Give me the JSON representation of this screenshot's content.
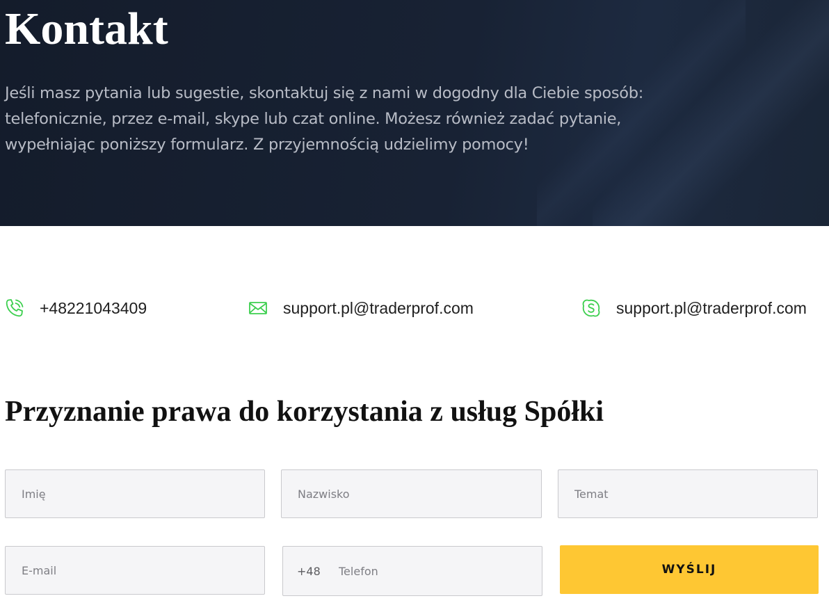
{
  "hero": {
    "title": "Kontakt",
    "text": "Jeśli masz pytania lub sugestie, skontaktuj się z nami w dogodny dla Ciebie sposób: telefonicznie, przez e-mail, skype lub czat online. Możesz również zadać pytanie, wypełniając poniższy formularz. Z przyjemnością udzielimy pomocy!"
  },
  "contacts": {
    "phone": {
      "icon": "phone-icon",
      "value": "+48221043409"
    },
    "email": {
      "icon": "mail-icon",
      "value": "support.pl@traderprof.com"
    },
    "skype": {
      "icon": "skype-icon",
      "value": "support.pl@traderprof.com"
    },
    "accent_color": "#3ccf4e"
  },
  "form": {
    "title": "Przyznanie prawa do korzystania z usług Spółki",
    "first_name_placeholder": "Imię",
    "last_name_placeholder": "Nazwisko",
    "subject_placeholder": "Temat",
    "email_placeholder": "E-mail",
    "phone_prefix": "+48",
    "phone_placeholder": "Telefon",
    "submit_label": "WYŚLIJ",
    "submit_color": "#fec733"
  }
}
